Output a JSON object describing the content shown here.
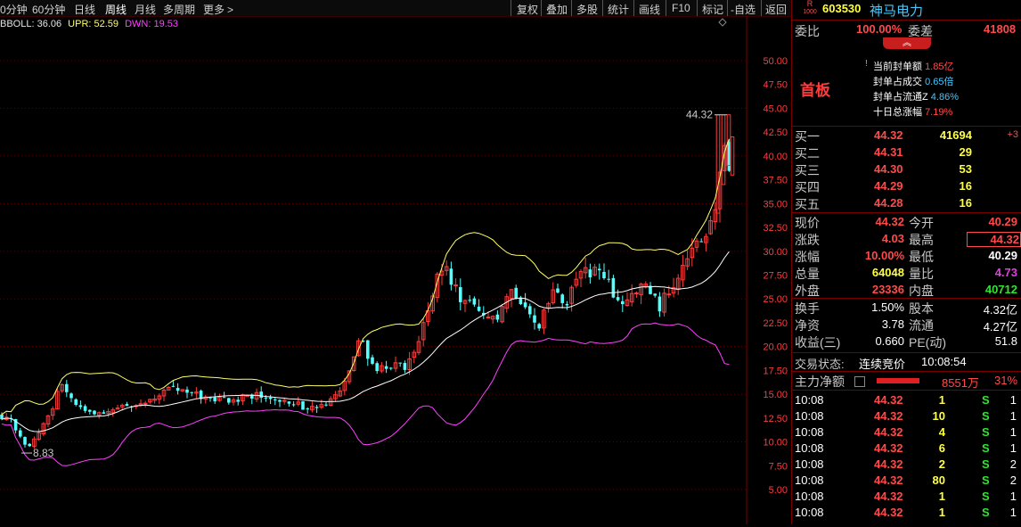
{
  "toolbar": {
    "left_items": [
      "0分钟",
      "60分钟",
      "日线",
      "周线",
      "月线",
      "多周期",
      "更多"
    ],
    "active_item": "周线",
    "more_arrow": ">",
    "right_items": [
      "复权",
      "叠加",
      "多股",
      "统计",
      "画线",
      "F10",
      "标记",
      "-自选",
      "返回"
    ]
  },
  "indicator": {
    "boll": "BBOLL: 36.06",
    "upr": "UPR: 52.59",
    "dwn": "DWN: 19.53",
    "colors": {
      "boll": "#e6e6e6",
      "upr": "#ffff66",
      "dwn": "#ff40ff"
    }
  },
  "chart_data": {
    "type": "candlestick",
    "y_ticks": [
      "50.00",
      "47.50",
      "45.00",
      "42.50",
      "40.00",
      "37.50",
      "35.00",
      "32.50",
      "30.00",
      "27.50",
      "25.00",
      "22.50",
      "20.00",
      "17.50",
      "15.00",
      "12.50",
      "10.00",
      "7.50",
      "5.00"
    ],
    "ylim": [
      3.2,
      52.0
    ],
    "annotations": {
      "high": "44.32",
      "low": "8.83"
    },
    "colors": {
      "up": "#ff3c3c",
      "down": "#54ffff",
      "mid": "#ffffff",
      "upper": "#ffff66",
      "lower": "#ff40ff"
    }
  },
  "header": {
    "badge_top": "R",
    "badge_bottom": "1000",
    "code": "603530",
    "name": "神马电力"
  },
  "weibi": {
    "label": "委比",
    "value": "100.00%",
    "diff_label": "委差",
    "diff_value": "41808",
    "toggle": "︽"
  },
  "seal": {
    "tag": "首板",
    "items": [
      {
        "label": "当前封单额",
        "value": "1.85亿"
      },
      {
        "label": "封单占成交",
        "value": "0.65倍"
      },
      {
        "label": "封单占流通Z",
        "value": "4.86%"
      },
      {
        "label": "十日总涨幅",
        "value": "7.19%"
      }
    ]
  },
  "bids": [
    {
      "label": "买一",
      "price": "44.32",
      "vol": "41694",
      "chg": "+3"
    },
    {
      "label": "买二",
      "price": "44.31",
      "vol": "29",
      "chg": ""
    },
    {
      "label": "买三",
      "price": "44.30",
      "vol": "53",
      "chg": ""
    },
    {
      "label": "买四",
      "price": "44.29",
      "vol": "16",
      "chg": ""
    },
    {
      "label": "买五",
      "price": "44.28",
      "vol": "16",
      "chg": ""
    }
  ],
  "quote": [
    {
      "l1": "现价",
      "v1": "44.32",
      "l2": "今开",
      "v2": "40.29"
    },
    {
      "l1": "涨跌",
      "v1": "4.03",
      "l2": "最高",
      "v2": "44.32"
    },
    {
      "l1": "涨幅",
      "v1": "10.00%",
      "l2": "最低",
      "v2": "40.29"
    },
    {
      "l1": "总量",
      "v1": "64048",
      "l2": "量比",
      "v2": "4.73"
    },
    {
      "l1": "外盘",
      "v1": "23336",
      "l2": "内盘",
      "v2": "40712"
    }
  ],
  "fundamentals": [
    {
      "l1": "换手",
      "v1": "1.50%",
      "l2": "股本",
      "v2": "4.32亿"
    },
    {
      "l1": "净资",
      "v1": "3.78",
      "l2": "流通",
      "v2": "4.27亿"
    },
    {
      "l1": "收益(三)",
      "v1": "0.660",
      "l2": "PE(动)",
      "v2": "51.8"
    }
  ],
  "status": {
    "label": "交易状态:",
    "value": "连续竞价",
    "time": "10:08:54"
  },
  "main_flow": {
    "label": "主力净额",
    "value": "8551万",
    "pct": "31%"
  },
  "ticks": [
    {
      "time": "10:08",
      "price": "44.32",
      "vol": "1",
      "side": "S",
      "n": "1"
    },
    {
      "time": "10:08",
      "price": "44.32",
      "vol": "10",
      "side": "S",
      "n": "1"
    },
    {
      "time": "10:08",
      "price": "44.32",
      "vol": "4",
      "side": "S",
      "n": "1"
    },
    {
      "time": "10:08",
      "price": "44.32",
      "vol": "6",
      "side": "S",
      "n": "1"
    },
    {
      "time": "10:08",
      "price": "44.32",
      "vol": "2",
      "side": "S",
      "n": "2"
    },
    {
      "time": "10:08",
      "price": "44.32",
      "vol": "80",
      "side": "S",
      "n": "2"
    },
    {
      "time": "10:08",
      "price": "44.32",
      "vol": "1",
      "side": "S",
      "n": "1"
    },
    {
      "time": "10:08",
      "price": "44.32",
      "vol": "1",
      "side": "S",
      "n": "1"
    }
  ]
}
